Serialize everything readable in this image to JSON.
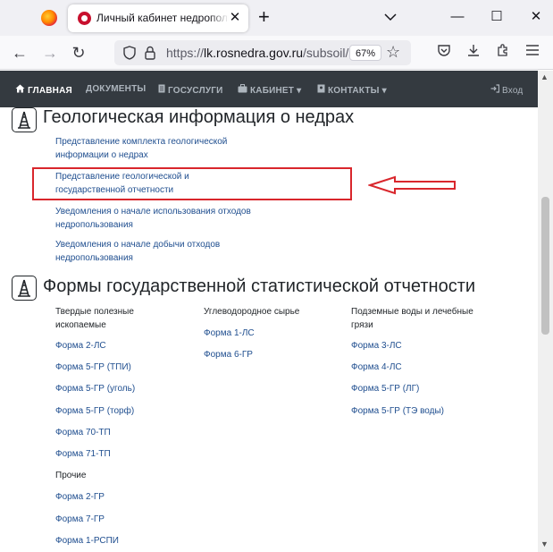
{
  "browser": {
    "tab_title": "Личный кабинет недропользователя",
    "url_host": "lk.rosnedra.gov.ru",
    "url_prefix": "https://",
    "url_path": "/subsoil/",
    "zoom": "67%"
  },
  "sitenav": {
    "items": [
      {
        "label": "ГЛАВНАЯ",
        "icon": "home-icon"
      },
      {
        "label": "ДОКУМЕНТЫ"
      },
      {
        "label": "ГОСУСЛУГИ",
        "icon": "document-icon"
      },
      {
        "label": "КАБИНЕТ",
        "icon": "briefcase-icon"
      },
      {
        "label": "КОНТАКТЫ",
        "icon": "contacts-icon"
      }
    ],
    "login": "Вход"
  },
  "geo": {
    "title": "Геологическая информация о недрах",
    "links": [
      [
        "Представление комплекта геологической",
        "информации о недрах"
      ],
      [
        "Представление геологической и",
        "государственной отчетности"
      ],
      [
        "Уведомления о начале использования отходов",
        "недропользования"
      ],
      [
        "Уведомления о начале добычи отходов",
        "недропользования"
      ]
    ]
  },
  "stat": {
    "title": "Формы государственной статистической отчетности",
    "col1": {
      "heading": [
        "Твердые полезные",
        "ископаемые"
      ],
      "links": [
        "Форма 2-ЛС",
        "Форма 5-ГР (ТПИ)",
        "Форма 5-ГР (уголь)",
        "Форма 5-ГР (торф)",
        "Форма 70-ТП",
        "Форма 71-ТП"
      ],
      "subheading": "Прочие",
      "links2": [
        "Форма 2-ГР",
        "Форма 7-ГР",
        "Форма 1-РСПИ"
      ]
    },
    "col2": {
      "heading": "Углеводородное сырье",
      "links": [
        "Форма 1-ЛС",
        "Форма 6-ГР"
      ]
    },
    "col3": {
      "heading": [
        "Подземные воды и лечебные",
        "грязи"
      ],
      "links": [
        "Форма 3-ЛС",
        "Форма 4-ЛС",
        "Форма 5-ГР (ЛГ)",
        "Форма 5-ГР (ТЭ воды)"
      ]
    }
  },
  "colors": {
    "nav_bg": "#343a40",
    "link": "#1f4e8f",
    "annotation": "#d9262c"
  }
}
